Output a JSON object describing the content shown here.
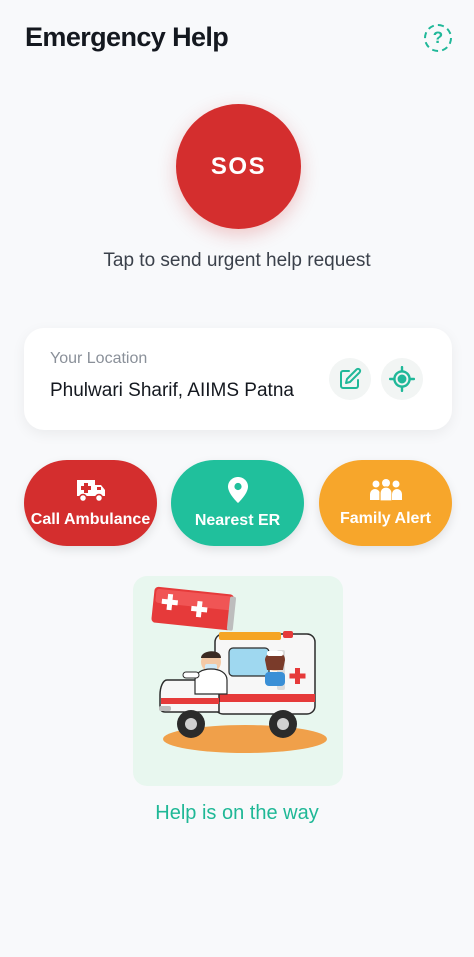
{
  "header": {
    "title": "Emergency Help",
    "help_icon": "question-circle-icon",
    "help_glyph": "?"
  },
  "sos": {
    "label": "SOS",
    "caption": "Tap to send urgent help request",
    "color": "#d42e2e"
  },
  "location": {
    "label": "Your Location",
    "value": "Phulwari Sharif, AIIMS Patna",
    "edit_icon": "pencil-edit-icon",
    "locate_icon": "crosshair-target-icon"
  },
  "actions": [
    {
      "label": "Call Ambulance",
      "icon": "ambulance-icon",
      "color": "#d42e2e"
    },
    {
      "label": "Nearest ER",
      "icon": "map-pin-icon",
      "color": "#20c09c"
    },
    {
      "label": "Family Alert",
      "icon": "people-group-icon",
      "color": "#f7a62b"
    }
  ],
  "illustration": {
    "icon": "ambulance-with-doctor-illustration",
    "caption": "Help is on the way"
  },
  "colors": {
    "accent": "#20b899",
    "background": "#f8f9fb"
  }
}
